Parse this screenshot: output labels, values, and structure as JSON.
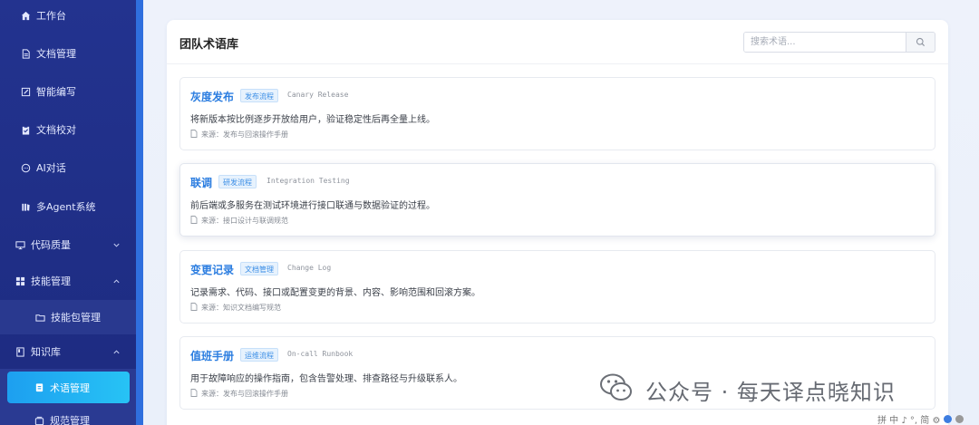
{
  "sidebar": {
    "items": [
      {
        "label": "工作台",
        "icon": "home-icon"
      },
      {
        "label": "文档管理",
        "icon": "document-icon"
      },
      {
        "label": "智能编写",
        "icon": "edit-icon"
      },
      {
        "label": "文档校对",
        "icon": "clipboard-check-icon"
      },
      {
        "label": "AI对话",
        "icon": "chat-icon"
      },
      {
        "label": "多Agent系统",
        "icon": "agents-icon"
      },
      {
        "label": "代码质量",
        "icon": "monitor-icon"
      },
      {
        "label": "技能管理",
        "icon": "grid-icon"
      },
      {
        "label": "技能包管理",
        "icon": "folder-icon"
      },
      {
        "label": "知识库",
        "icon": "book-icon"
      },
      {
        "label": "术语管理",
        "icon": "term-icon"
      },
      {
        "label": "规范管理",
        "icon": "standard-icon"
      }
    ]
  },
  "main": {
    "title": "团队术语库",
    "search_placeholder": "搜索术语...",
    "terms": [
      {
        "term": "灰度发布",
        "tag": "发布流程",
        "english": "Canary Release",
        "description": "将新版本按比例逐步开放给用户，验证稳定性后再全量上线。",
        "source": "来源：发布与回滚操作手册"
      },
      {
        "term": "联调",
        "tag": "研发流程",
        "english": "Integration Testing",
        "description": "前后端或多服务在测试环境进行接口联通与数据验证的过程。",
        "source": "来源：接口设计与联调规范"
      },
      {
        "term": "变更记录",
        "tag": "文档管理",
        "english": "Change Log",
        "description": "记录需求、代码、接口或配置变更的背景、内容、影响范围和回滚方案。",
        "source": "来源：知识文档编写规范"
      },
      {
        "term": "值班手册",
        "tag": "运维流程",
        "english": "On-call Runbook",
        "description": "用于故障响应的操作指南，包含告警处理、排查路径与升级联系人。",
        "source": "来源：发布与回滚操作手册"
      }
    ]
  },
  "watermark": {
    "text": "公众号 · 每天译点晓知识"
  },
  "ime": {
    "text": "拼 中 ♪ °, 简 ⚙"
  },
  "colors": {
    "sidebar": "#23338f",
    "active": "#1d9ff0",
    "term": "#2b7de0",
    "tag": "#3b8ee6"
  }
}
